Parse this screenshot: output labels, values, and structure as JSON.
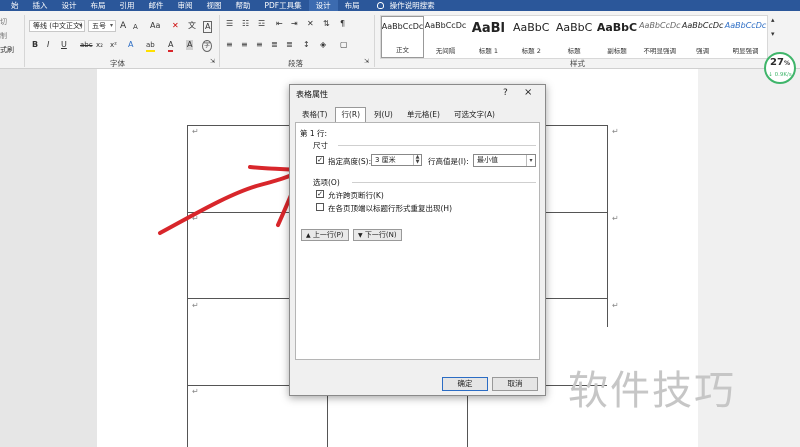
{
  "ribbon": {
    "tabs": [
      "始",
      "插入",
      "设计",
      "布局",
      "引用",
      "邮件",
      "审阅",
      "视图",
      "帮助",
      "PDF工具集",
      "设计",
      "布局"
    ],
    "active_tab_index": 10,
    "tell_me": "操作说明搜索",
    "clipboard": {
      "cut": "切",
      "copy": "制",
      "format_painter": "式刷"
    },
    "font": {
      "name": "等线 (中文正文)",
      "size": "五号",
      "grow": "A",
      "shrink": "A",
      "clear": "Aa",
      "phonetic": "文",
      "border_char": "A",
      "bold": "B",
      "italic": "I",
      "underline": "U",
      "strike": "abc",
      "sub": "x₂",
      "sup": "x²",
      "effects": "A",
      "highlight": "ab",
      "color": "A",
      "shade": "A",
      "enclose": "字",
      "group_label": "字体"
    },
    "paragraph": {
      "group_label": "段落"
    },
    "styles": {
      "group_label": "样式",
      "items": [
        {
          "sample": "AaBbCcDc",
          "name": "正文"
        },
        {
          "sample": "AaBbCcDc",
          "name": "无间隔"
        },
        {
          "sample": "AaBl",
          "name": "标题 1"
        },
        {
          "sample": "AaBbC",
          "name": "标题 2"
        },
        {
          "sample": "AaBbC",
          "name": "标题"
        },
        {
          "sample": "AaBbC",
          "name": "副标题"
        },
        {
          "sample": "AaBbCcDc",
          "name": "不明显强调"
        },
        {
          "sample": "AaBbCcDc",
          "name": "强调"
        },
        {
          "sample": "AaBbCcDc",
          "name": "明显强调"
        }
      ]
    }
  },
  "network": {
    "percent": "27",
    "unit": "%",
    "rate": "↓ 0.9K/s"
  },
  "dialog": {
    "title": "表格属性",
    "help": "?",
    "close": "×",
    "tabs": [
      "表格(T)",
      "行(R)",
      "列(U)",
      "单元格(E)",
      "可选文字(A)"
    ],
    "active_tab_index": 1,
    "row_label": "第 1 行:",
    "size_section": "尺寸",
    "specify_height": {
      "label": "指定高度(S):",
      "checked": true
    },
    "height_value": "3 厘米",
    "height_mode_label": "行高值是(I):",
    "height_mode_value": "最小值",
    "options_section": "选项(O)",
    "allow_break": {
      "label": "允许跨页断行(K)",
      "checked": true
    },
    "repeat_header": {
      "label": "在各页顶端以标题行形式重复出现(H)",
      "checked": false
    },
    "prev_row": "上一行(P)",
    "next_row": "下一行(N)",
    "ok": "确定",
    "cancel": "取消"
  },
  "document": {
    "paragraph_mark": "↵"
  },
  "watermark": "软件技巧",
  "colors": {
    "ribbon_blue": "#2b579a",
    "annotation_red": "#d8262b",
    "speed_green": "#3fb56a"
  }
}
